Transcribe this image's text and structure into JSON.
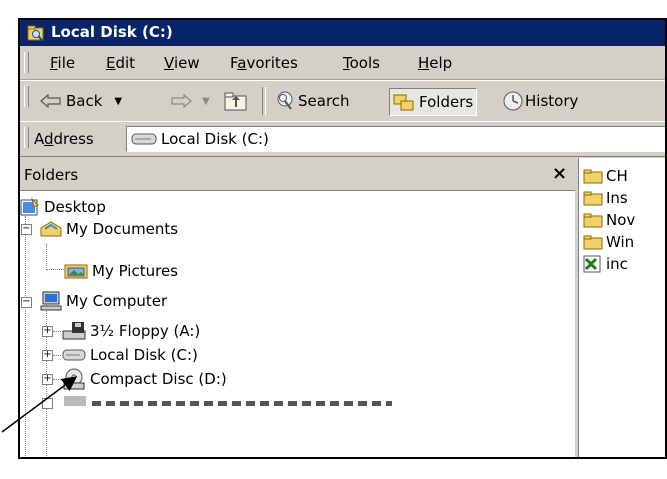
{
  "window": {
    "title": "Local Disk (C:)"
  },
  "menubar": {
    "items": [
      {
        "pre": "",
        "u": "F",
        "post": "ile"
      },
      {
        "pre": "",
        "u": "E",
        "post": "dit"
      },
      {
        "pre": "",
        "u": "V",
        "post": "iew"
      },
      {
        "pre": "F",
        "u": "a",
        "post": "vorites"
      },
      {
        "pre": "",
        "u": "T",
        "post": "ools"
      },
      {
        "pre": "",
        "u": "H",
        "post": "elp"
      }
    ]
  },
  "toolbar": {
    "back_label": "Back",
    "search_label": "Search",
    "folders_label": "Folders",
    "history_label": "History"
  },
  "address": {
    "label_pre": "A",
    "label_u": "d",
    "label_post": "dress",
    "value": "Local Disk (C:)"
  },
  "folders_pane": {
    "title": "Folders",
    "close_glyph": "×",
    "tree": {
      "desktop": "Desktop",
      "my_documents": "My Documents",
      "my_pictures": "My Pictures",
      "my_computer": "My Computer",
      "floppy": "3½ Floppy (A:)",
      "local_disk": "Local Disk (C:)",
      "compact_disc": "Compact Disc (D:)"
    },
    "expander_minus": "−",
    "expander_plus": "+"
  },
  "contents_pane": {
    "items": [
      "CH",
      "Ins",
      "Nov",
      "Win",
      "inc"
    ]
  }
}
